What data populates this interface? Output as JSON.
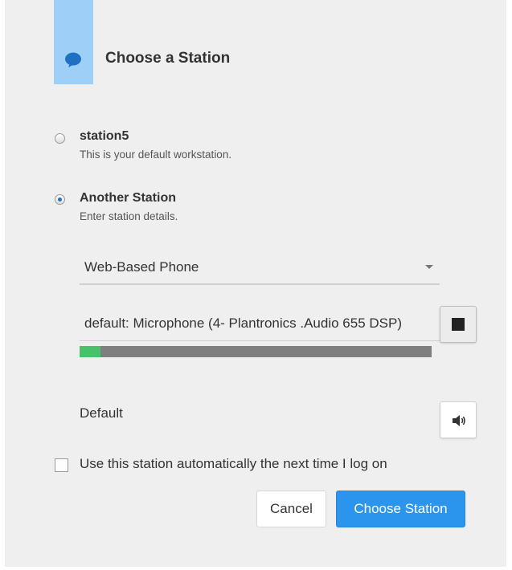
{
  "dialog": {
    "title": "Choose a Station",
    "icon": "chat-bubble-icon",
    "accent_color": "#9ed0f7"
  },
  "options": [
    {
      "title": "station5",
      "description": "This is your default workstation.",
      "selected": false
    },
    {
      "title": "Another Station",
      "description": "Enter station details.",
      "selected": true
    }
  ],
  "station_type": {
    "selected": "Web-Based Phone"
  },
  "microphone": {
    "value": "default: Microphone (4- Plantronics .Audio 655 DSP)",
    "level_percent": 6,
    "level_color": "#49c06a",
    "stop_icon": "stop-icon"
  },
  "speaker": {
    "label": "Default",
    "icon": "speaker-icon"
  },
  "auto_use": {
    "label": "Use this station automatically the next time I log on",
    "checked": false
  },
  "buttons": {
    "cancel": "Cancel",
    "choose": "Choose Station",
    "primary_color": "#2b95ee"
  }
}
